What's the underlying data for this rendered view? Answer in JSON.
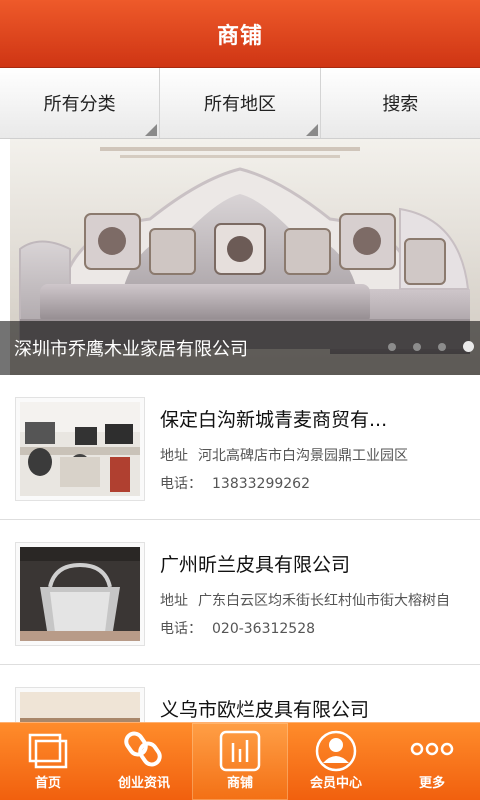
{
  "header": {
    "title": "商铺"
  },
  "filters": [
    {
      "label": "所有分类"
    },
    {
      "label": "所有地区"
    },
    {
      "label": "搜索"
    }
  ],
  "banner": {
    "caption": "深圳市乔鹰木业家居有限公司",
    "dots": 4,
    "active_dot": 4
  },
  "shops": [
    {
      "name": "保定白沟新城青麦商贸有...",
      "address_label": "地址",
      "address": "河北高碑店市白沟景园鼎工业园区",
      "phone_label": "电话：",
      "phone": "13833299262",
      "thumb": "office-photo"
    },
    {
      "name": "广州昕兰皮具有限公司",
      "address_label": "地址",
      "address": "广东白云区均禾街长红村仙市街大榕树自",
      "phone_label": "电话：",
      "phone": "020-36312528",
      "thumb": "handbag-photo"
    },
    {
      "name": "义乌市欧烂皮具有限公司",
      "thumb": "product-photo"
    }
  ],
  "bottom_nav": [
    {
      "label": "首页",
      "icon": "home-icon"
    },
    {
      "label": "创业资讯",
      "icon": "link-icon"
    },
    {
      "label": "商铺",
      "icon": "chart-icon",
      "active": true
    },
    {
      "label": "会员中心",
      "icon": "user-icon"
    },
    {
      "label": "更多",
      "icon": "more-icon"
    }
  ],
  "colors": {
    "header": "#e04a1f",
    "nav": "#f57a1c"
  }
}
